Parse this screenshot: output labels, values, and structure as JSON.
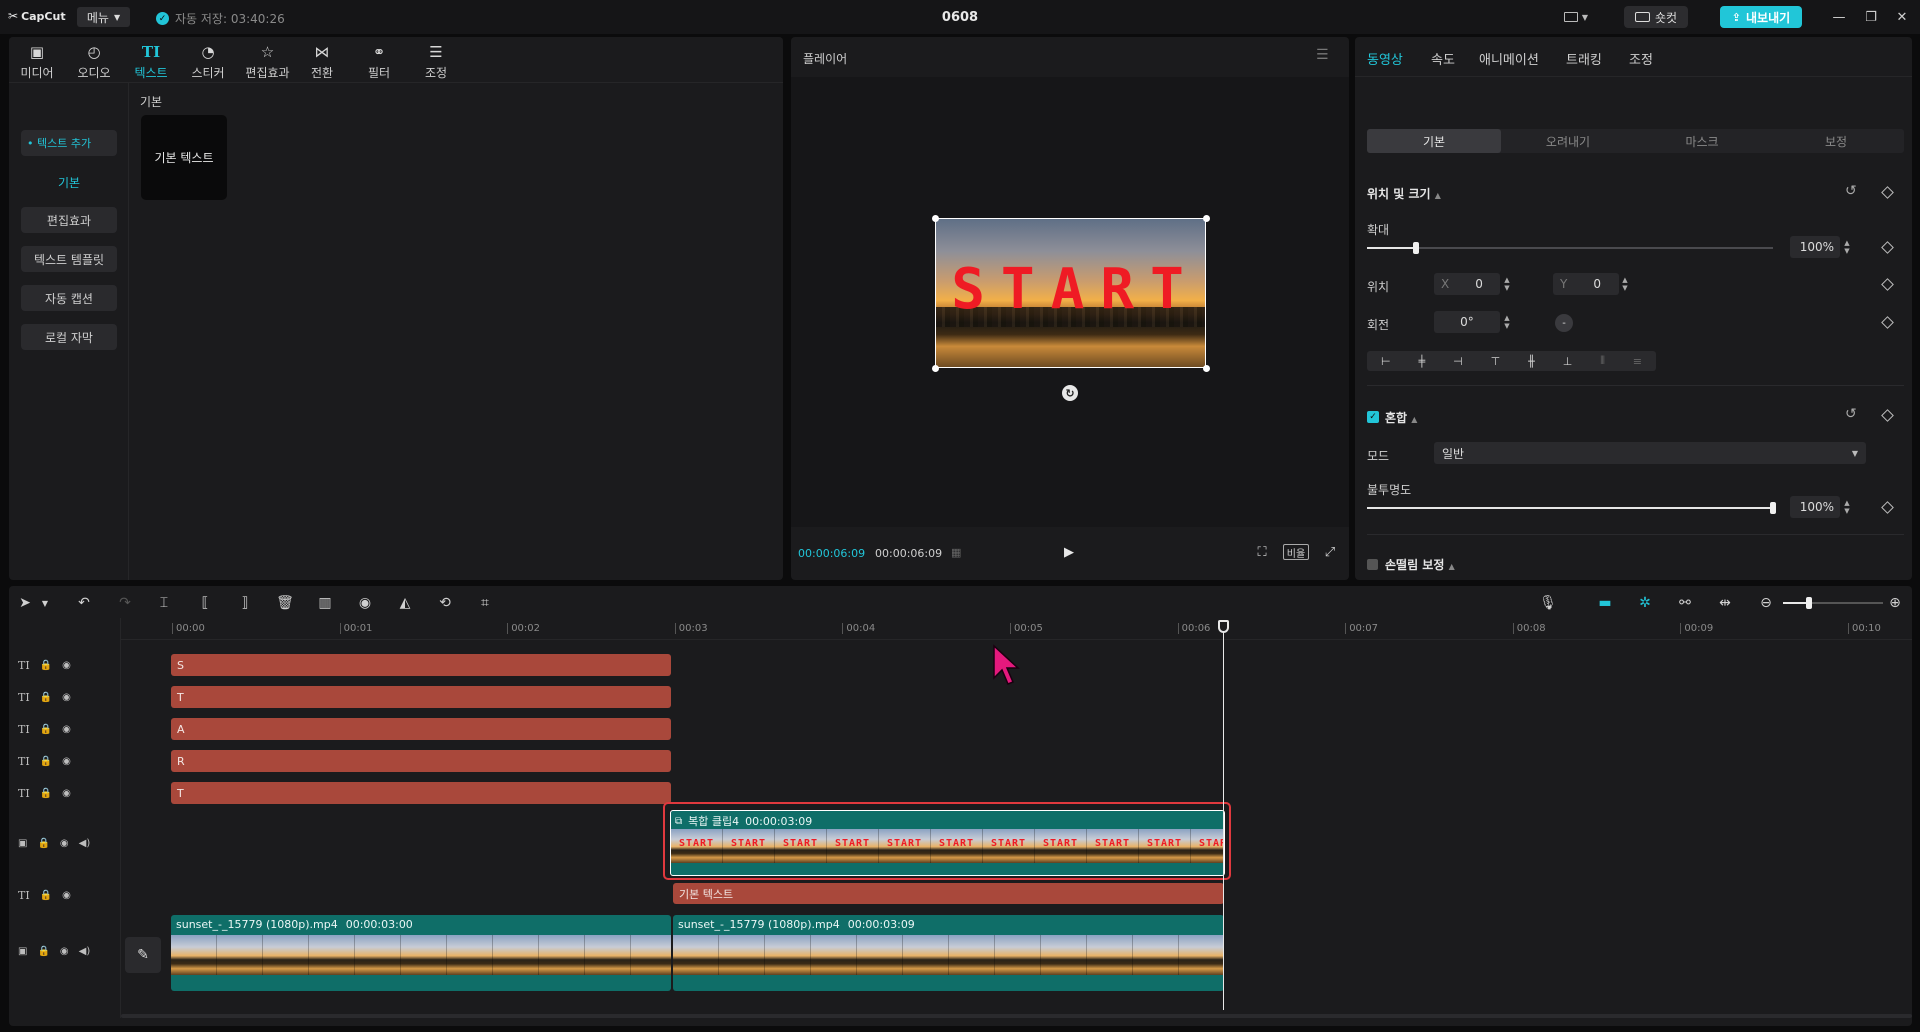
{
  "app": {
    "logo": "CapCut",
    "menu_label": "메뉴",
    "autosave": "자동 저장: 03:40:26",
    "project_title": "0608",
    "shortcut_label": "숏컷",
    "export_label": "내보내기"
  },
  "media_toolbar": {
    "items": [
      {
        "label": "미디어",
        "icon": "media-icon"
      },
      {
        "label": "오디오",
        "icon": "audio-icon"
      },
      {
        "label": "텍스트",
        "icon": "text-icon",
        "active": true
      },
      {
        "label": "스티커",
        "icon": "sticker-icon"
      },
      {
        "label": "편집효과",
        "icon": "effects-icon"
      },
      {
        "label": "전환",
        "icon": "transition-icon"
      },
      {
        "label": "필터",
        "icon": "filter-icon"
      },
      {
        "label": "조정",
        "icon": "adjust-icon"
      }
    ]
  },
  "text_sidebar": {
    "items": [
      "• 텍스트 추가",
      "기본",
      "편집효과",
      "텍스트 템플릿",
      "자동 캡션",
      "로컬 자막"
    ]
  },
  "text_library": {
    "section": "기본",
    "card_label": "기본 텍스트"
  },
  "player": {
    "title": "플레이어",
    "preview_text": "START",
    "current_time": "00:00:06:09",
    "total_time": "00:00:06:09",
    "ratio_label": "비율"
  },
  "inspector": {
    "tabs": [
      "동영상",
      "속도",
      "애니메이션",
      "트래킹",
      "조정"
    ],
    "active_tab": "동영상",
    "subtabs": [
      "기본",
      "오려내기",
      "마스크",
      "보정"
    ],
    "position_section": "위치 및 크기",
    "scale_label": "확대",
    "scale_value": "100%",
    "scale_level": 0.12,
    "position_label": "위치",
    "x_label": "X",
    "x_value": "0",
    "y_label": "Y",
    "y_value": "0",
    "rotation_label": "회전",
    "rotation_value": "0°",
    "blend_section": "혼합",
    "mode_label": "모드",
    "mode_value": "일반",
    "opacity_label": "불투명도",
    "opacity_value": "100%",
    "opacity_level": 1.0,
    "stabilize_section": "손떨림 보정"
  },
  "timeline": {
    "ruler": [
      "00:00",
      "00:01",
      "00:02",
      "00:03",
      "00:04",
      "00:05",
      "00:06",
      "00:07",
      "00:08",
      "00:09",
      "00:10"
    ],
    "text_clips": [
      "S",
      "T",
      "A",
      "R",
      "T"
    ],
    "compound_clip": {
      "name": "복합 클립4",
      "duration": "00:00:03:09"
    },
    "basic_text_clip": "기본 텍스트",
    "video_clips": [
      {
        "name": "sunset_-_15779 (1080p).mp4",
        "duration": "00:00:03:00"
      },
      {
        "name": "sunset_-_15779 (1080p).mp4",
        "duration": "00:00:03:09"
      }
    ]
  },
  "colors": {
    "accent": "#22c5d8",
    "text_clip": "#a9483b",
    "video_clip": "#0f6e68",
    "selection": "#e0393e",
    "cursor": "#e5197d"
  }
}
